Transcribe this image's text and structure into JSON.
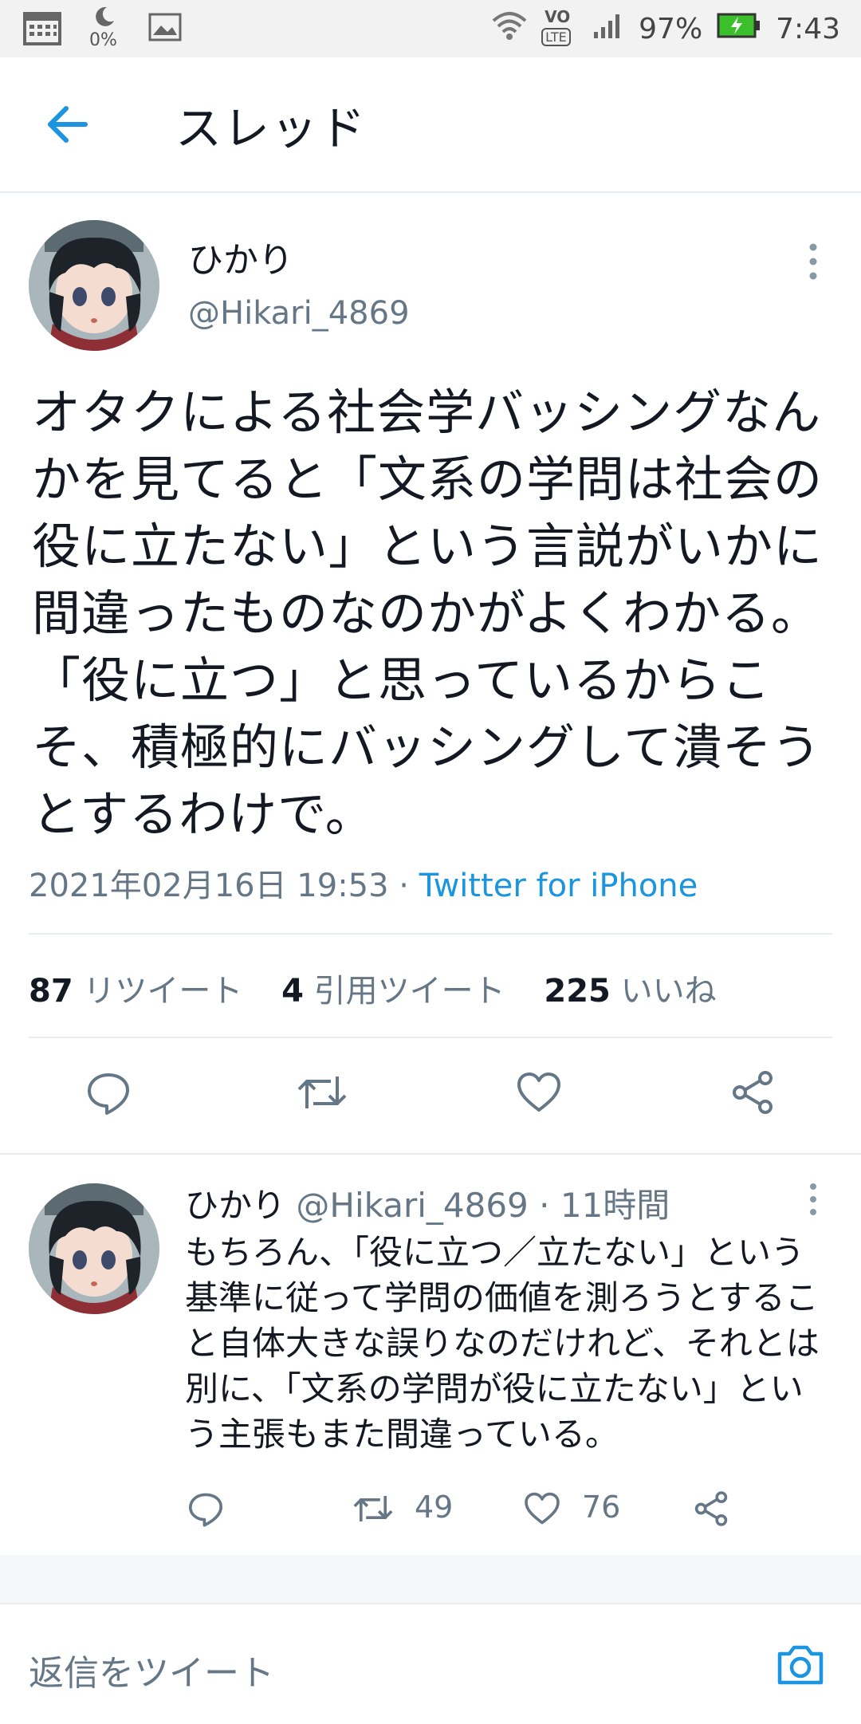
{
  "status_bar": {
    "data_usage": "0%",
    "battery": "97%",
    "time": "7:43",
    "network_badge": "LTE",
    "icons": [
      "calendar-icon",
      "moon-icon",
      "image-icon",
      "wifi-icon",
      "volte-icon",
      "signal-icon",
      "battery-icon"
    ]
  },
  "header": {
    "title": "スレッド"
  },
  "main_tweet": {
    "name": "ひかり",
    "handle": "@Hikari_4869",
    "text": "オタクによる社会学バッシングなんかを見てると「文系の学問は社会の役に立たない」という言説がいかに間違ったものなのかがよくわかる。「役に立つ」と思っているからこそ、積極的にバッシングして潰そうとするわけで。",
    "timestamp": "2021年02月16日 19:53",
    "via": "Twitter for iPhone",
    "retweets": "87",
    "retweets_label": "リツイート",
    "quotes": "4",
    "quotes_label": "引用ツイート",
    "likes": "225",
    "likes_label": "いいね"
  },
  "reply_tweet": {
    "name": "ひかり",
    "handle": "@Hikari_4869",
    "time_ago": "11時間",
    "text": "もちろん、「役に立つ／立たない」という基準に従って学問の価値を測ろうとすること自体大きな誤りなのだけれど、それとは別に、「文系の学問が役に立たない」という主張もまた間違っている。",
    "retweets": "49",
    "likes": "76"
  },
  "compose": {
    "placeholder": "返信をツイート"
  },
  "colors": {
    "accent": "#1b95e0",
    "secondary_text": "#657786",
    "divider": "#e6ecf0",
    "battery": "#3bbf2b"
  }
}
